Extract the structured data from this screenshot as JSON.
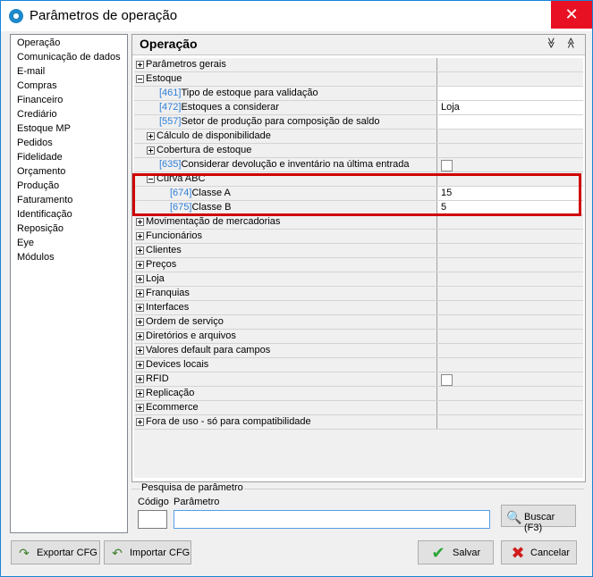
{
  "window": {
    "title": "Parâmetros de operação",
    "close_glyph": "✕"
  },
  "nav": {
    "items": [
      "Operação",
      "Comunicação de dados",
      "E-mail",
      "Compras",
      "Financeiro",
      "Crediário",
      "Estoque MP",
      "Pedidos",
      "Fidelidade",
      "Orçamento",
      "Produção",
      "Faturamento",
      "Identificação",
      "Reposição",
      "Eye",
      "Módulos"
    ]
  },
  "main": {
    "title": "Operação",
    "collapse_all_glyph": "≫",
    "expand_all_glyph": "≪"
  },
  "grid": {
    "rows": [
      {
        "level": 0,
        "expander": "collapsed",
        "code": "",
        "label": "Parâmetros gerais",
        "value": ""
      },
      {
        "level": 0,
        "expander": "expanded",
        "code": "",
        "label": "Estoque",
        "value": ""
      },
      {
        "level": 1,
        "expander": "",
        "code": "[461]",
        "label": "Tipo de estoque para validação",
        "value": ""
      },
      {
        "level": 1,
        "expander": "",
        "code": "[472]",
        "label": "Estoques a considerar",
        "value": "Loja"
      },
      {
        "level": 1,
        "expander": "",
        "code": "[557]",
        "label": "Setor de produção para composição de saldo",
        "value": ""
      },
      {
        "level": 1,
        "expander": "collapsed",
        "code": "",
        "label": "Cálculo de disponibilidade",
        "value": ""
      },
      {
        "level": 1,
        "expander": "collapsed",
        "code": "",
        "label": "Cobertura de estoque",
        "value": ""
      },
      {
        "level": 1,
        "expander": "",
        "code": "[635]",
        "label": "Considerar devolução e inventário na última entrada",
        "value": "",
        "checkbox": true
      },
      {
        "level": 1,
        "expander": "expanded",
        "code": "",
        "label": "Curva ABC",
        "value": ""
      },
      {
        "level": 2,
        "expander": "",
        "code": "[674]",
        "label": "Classe A",
        "value": "15"
      },
      {
        "level": 2,
        "expander": "",
        "code": "[675]",
        "label": "Classe B",
        "value": "5"
      },
      {
        "level": 0,
        "expander": "collapsed",
        "code": "",
        "label": "Movimentação de mercadorias",
        "value": ""
      },
      {
        "level": 0,
        "expander": "collapsed",
        "code": "",
        "label": "Funcionários",
        "value": ""
      },
      {
        "level": 0,
        "expander": "collapsed",
        "code": "",
        "label": "Clientes",
        "value": ""
      },
      {
        "level": 0,
        "expander": "collapsed",
        "code": "",
        "label": "Preços",
        "value": ""
      },
      {
        "level": 0,
        "expander": "collapsed",
        "code": "",
        "label": "Loja",
        "value": ""
      },
      {
        "level": 0,
        "expander": "collapsed",
        "code": "",
        "label": "Franquias",
        "value": ""
      },
      {
        "level": 0,
        "expander": "collapsed",
        "code": "",
        "label": "Interfaces",
        "value": ""
      },
      {
        "level": 0,
        "expander": "collapsed",
        "code": "",
        "label": "Ordem de serviço",
        "value": ""
      },
      {
        "level": 0,
        "expander": "collapsed",
        "code": "",
        "label": "Diretórios e arquivos",
        "value": ""
      },
      {
        "level": 0,
        "expander": "collapsed",
        "code": "",
        "label": "Valores default para campos",
        "value": ""
      },
      {
        "level": 0,
        "expander": "collapsed",
        "code": "",
        "label": "Devices locais",
        "value": ""
      },
      {
        "level": 0,
        "expander": "collapsed",
        "code": "",
        "label": "RFID",
        "value": "",
        "checkbox": true
      },
      {
        "level": 0,
        "expander": "collapsed",
        "code": "",
        "label": "Replicação",
        "value": ""
      },
      {
        "level": 0,
        "expander": "collapsed",
        "code": "",
        "label": "Ecommerce",
        "value": ""
      },
      {
        "level": 0,
        "expander": "collapsed",
        "code": "",
        "label": "Fora de uso - só para compatibilidade",
        "value": ""
      }
    ]
  },
  "search": {
    "title": "Pesquisa de parâmetro",
    "code_label": "Código",
    "param_label": "Parâmetro",
    "code_value": "",
    "param_value": "",
    "button": "Buscar (F3)"
  },
  "footer": {
    "export": "Exportar CFG",
    "import": "Importar CFG",
    "save": "Salvar",
    "cancel": "Cancelar"
  }
}
